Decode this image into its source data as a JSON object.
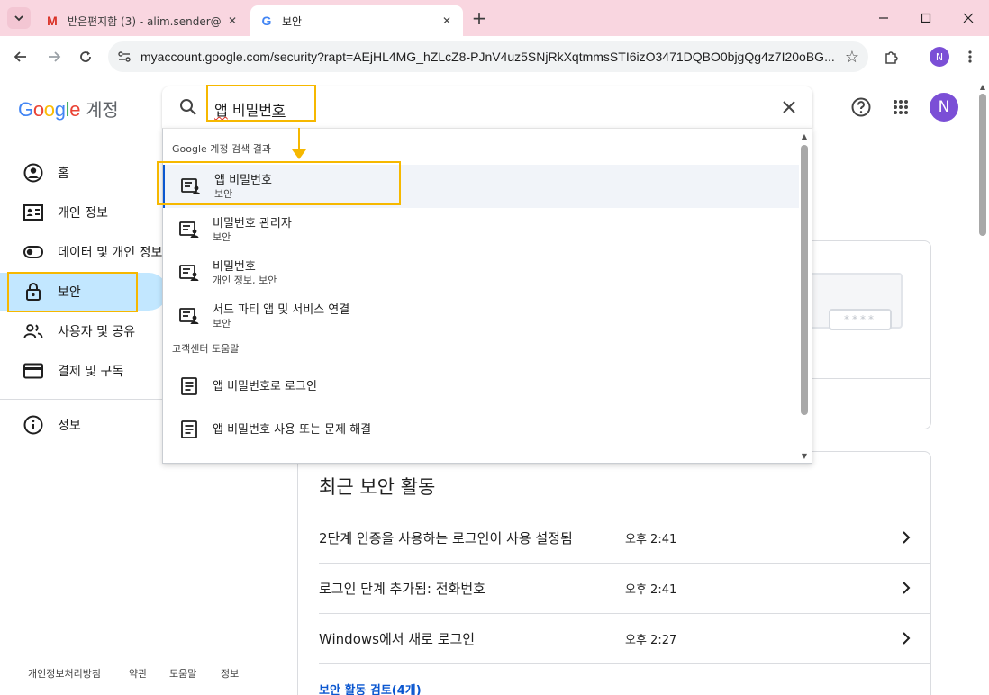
{
  "browser": {
    "tabs": [
      {
        "title": "받은편지함 (3) - alim.sender@",
        "favicon": "gmail-icon",
        "favicon_color": "#d93025"
      },
      {
        "title": "보안",
        "favicon": "google-icon",
        "favicon_color": "#4285f4"
      }
    ],
    "url": "myaccount.google.com/security?rapt=AEjHL4MG_hZLcZ8-PJnV4uz5SNjRkXqtmmsSTI6izO3471DQBO0bjgQg4z7I20oBG...",
    "profile_initial": "N"
  },
  "header": {
    "logo": {
      "g1": "G",
      "o1": "o",
      "o2": "o",
      "g2": "g",
      "l": "l",
      "e": "e"
    },
    "account_label": "계정",
    "search": {
      "prefix_spellcheck": "앱",
      "middle": " 비밀번",
      "suffix_cursor": "호"
    },
    "avatar_initial": "N"
  },
  "sidebar": {
    "items": [
      {
        "label": "홈",
        "icon": "account-circle-icon"
      },
      {
        "label": "개인 정보",
        "icon": "id-card-icon"
      },
      {
        "label": "데이터 및 개인 정보",
        "icon": "toggle-icon"
      },
      {
        "label": "보안",
        "icon": "lock-icon",
        "active": true
      },
      {
        "label": "사용자 및 공유",
        "icon": "people-icon"
      },
      {
        "label": "결제 및 구독",
        "icon": "credit-card-icon"
      },
      {
        "label": "정보",
        "icon": "info-icon"
      }
    ],
    "footer": [
      "개인정보처리방침",
      "약관",
      "도움말",
      "정보"
    ]
  },
  "dropdown": {
    "section_account": "Google 계정 검색 결과",
    "account_results": [
      {
        "title": "앱 비밀번호",
        "subtitle": "보안",
        "selected": true
      },
      {
        "title": "비밀번호 관리자",
        "subtitle": "보안"
      },
      {
        "title": "비밀번호",
        "subtitle": "개인 정보, 보안"
      },
      {
        "title": "서드 파티 앱 및 서비스 연결",
        "subtitle": "보안"
      }
    ],
    "section_help": "고객센터 도움말",
    "help_results": [
      {
        "title": "앱 비밀번호로 로그인"
      },
      {
        "title": "앱 비밀번호 사용 또는 문제 해결"
      }
    ]
  },
  "main": {
    "illustration_mask": "****",
    "recent_activity": {
      "title": "최근 보안 활동",
      "rows": [
        {
          "text": "2단계 인증을 사용하는 로그인이 사용 설정됨",
          "time": "오후 2:41"
        },
        {
          "text": "로그인 단계 추가됨: 전화번호",
          "time": "오후 2:41"
        },
        {
          "text": "Windows에서 새로 로그인",
          "time": "오후 2:27"
        }
      ],
      "review_link": "보안 활동 검토(4개)"
    }
  },
  "colors": {
    "highlight": "#f6b800",
    "accent_blue": "#0b57d0",
    "active_nav": "#c2e7ff",
    "avatar": "#7b4fd6"
  }
}
